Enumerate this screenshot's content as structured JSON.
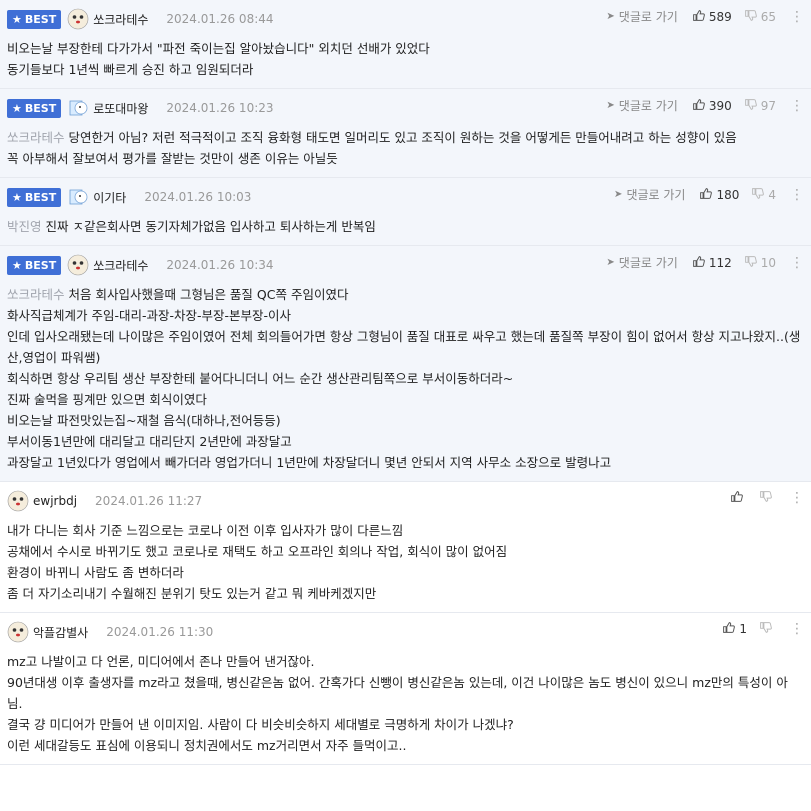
{
  "comments": [
    {
      "best": true,
      "badge": "BEST",
      "nick": "쏘크라테수",
      "date": "2024.01.26 08:44",
      "reply": "댓글로 가기",
      "up": "589",
      "down": "65",
      "mention": "",
      "lines": [
        "비오는날 부장한테 다가가서 \"파전 죽이는집 알아놨습니다\" 외치던 선배가 있었다",
        "동기들보다 1년씩 빠르게 승진 하고 임원되더라"
      ]
    },
    {
      "best": true,
      "badge": "BEST",
      "nick": "로또대마왕",
      "date": "2024.01.26 10:23",
      "reply": "댓글로 가기",
      "up": "390",
      "down": "97",
      "mention": "쏘크라테수",
      "lines": [
        "당연한거 아님? 저런 적극적이고 조직 융화형 태도면 일머리도 있고 조직이 원하는 것을 어떻게든 만들어내려고 하는 성향이 있음",
        "꼭 아부해서 잘보여서 평가를 잘받는 것만이 생존 이유는 아닐듯"
      ]
    },
    {
      "best": true,
      "badge": "BEST",
      "nick": "이기타",
      "date": "2024.01.26 10:03",
      "reply": "댓글로 가기",
      "up": "180",
      "down": "4",
      "mention": "박진영",
      "lines": [
        "진짜 ㅈ같은회사면 동기자체가없음 입사하고 퇴사하는게 반복임"
      ]
    },
    {
      "best": true,
      "badge": "BEST",
      "nick": "쏘크라테수",
      "date": "2024.01.26 10:34",
      "reply": "댓글로 가기",
      "up": "112",
      "down": "10",
      "mention": "쏘크라테수",
      "lines": [
        "처음 회사입사했을때 그형님은 품질 QC쪽 주임이였다",
        "화사직급체계가 주임-대리-과장-차장-부장-본부장-이사",
        "인데 입사오래됐는데 나이많은 주임이였어 전체 회의들어가면 항상 그형님이 품질 대표로 싸우고 했는데 품질쪽 부장이 힘이 없어서 항상 지고나왔지..(생산,영업이 파워쌤)",
        "회식하면 항상 우리팀 생산 부장한테 붙어다니더니 어느 순간 생산관리팀쪽으로 부서이동하더라~",
        "진짜 술먹을 핑계만 있으면 회식이였다",
        "비오는날 파전맛있는집~재철 음식(대하나,전어등등)",
        "부서이동1년만에 대리달고 대리단지 2년만에 과장달고",
        "과장달고 1년있다가 영업에서 빼가더라 영업가더니 1년만에 차장달더니 몇년 안되서 지역 사무소 소장으로 발령나고"
      ]
    },
    {
      "best": false,
      "badge": "",
      "nick": "ewjrbdj",
      "date": "2024.01.26 11:27",
      "reply": "",
      "up": "",
      "down": "",
      "mention": "",
      "lines": [
        "내가 다니는 회사 기준 느낌으로는 코로나 이전 이후 입사자가 많이 다른느낌",
        "공채에서 수시로 바뀌기도 했고 코로나로 재택도 하고 오프라인 회의나 작업, 회식이 많이 없어짐",
        "환경이 바뀌니 사람도 좀 변하더라",
        "좀 더 자기소리내기 수월해진 분위기 탓도 있는거 같고 뭐 케바케겠지만"
      ]
    },
    {
      "best": false,
      "badge": "",
      "nick": "악플감별사",
      "date": "2024.01.26 11:30",
      "reply": "",
      "up": "1",
      "down": "",
      "mention": "",
      "lines": [
        "mz고 나발이고 다 언론, 미디어에서 존나 만들어 낸거잖아.",
        "90년대생 이후 출생자를 mz라고 쳤을때, 병신같은놈 없어. 간혹가다 신뺑이 병신같은놈 있는데, 이건 나이많은 놈도 병신이 있으니 mz만의 특성이 아님.",
        "결국 걍 미디어가 만들어 낸 이미지임. 사람이 다 비슷비슷하지 세대별로 극명하게 차이가 나겠냐?",
        "이런 세대갈등도 표심에 이용되니 정치권에서도 mz거리면서 자주 들먹이고.."
      ]
    }
  ],
  "icons": {
    "badge_star": "star-icon",
    "reply": "reply-arrow-icon",
    "up": "thumbs-up-icon",
    "down": "thumbs-down-icon",
    "more": "more-icon"
  },
  "colors": {
    "best_badge": "#3f6fd6",
    "best_bg": "#f3f6fb",
    "mention": "#a0a4ad"
  }
}
